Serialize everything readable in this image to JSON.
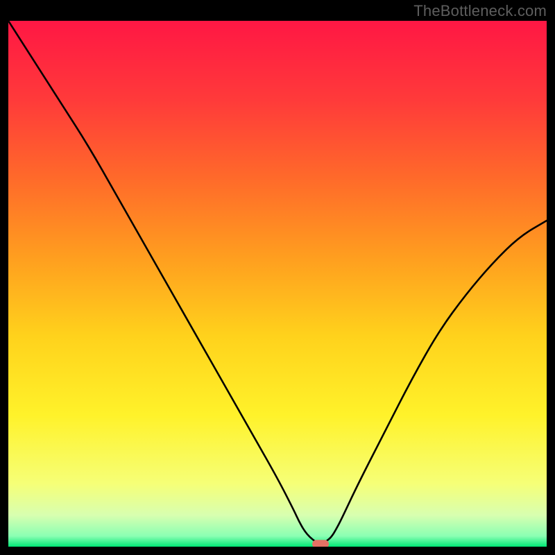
{
  "watermark": "TheBottleneck.com",
  "marker_color": "#e47165",
  "chart_data": {
    "type": "line",
    "title": "",
    "xlabel": "",
    "ylabel": "",
    "xlim": [
      0,
      100
    ],
    "ylim": [
      0,
      100
    ],
    "grid": false,
    "legend": false,
    "series": [
      {
        "name": "left-branch",
        "x": [
          0,
          5,
          10,
          15,
          20,
          25,
          30,
          35,
          40,
          45,
          50,
          53,
          54,
          55,
          56,
          57
        ],
        "values": [
          100,
          92,
          84,
          76,
          67,
          58,
          49,
          40,
          31,
          22,
          13,
          7,
          4.8,
          3,
          1.8,
          1.0
        ]
      },
      {
        "name": "right-branch",
        "x": [
          59,
          60,
          61,
          62,
          65,
          70,
          75,
          80,
          85,
          90,
          95,
          100
        ],
        "values": [
          1.0,
          1.8,
          3.5,
          5.5,
          12,
          22,
          32,
          41,
          48,
          54,
          59,
          62
        ]
      }
    ],
    "annotations": [
      {
        "name": "optimal-marker",
        "x": 58,
        "y": 0.5,
        "color": "#e47165"
      }
    ],
    "background": {
      "type": "vertical-gradient",
      "ylim": [
        0,
        100
      ],
      "stops": [
        {
          "y": 100,
          "color": "#ff1744"
        },
        {
          "y": 85,
          "color": "#ff3a3a"
        },
        {
          "y": 70,
          "color": "#ff6a2a"
        },
        {
          "y": 55,
          "color": "#ff9e1f"
        },
        {
          "y": 40,
          "color": "#ffd21c"
        },
        {
          "y": 25,
          "color": "#fff22a"
        },
        {
          "y": 12,
          "color": "#f6ff77"
        },
        {
          "y": 6,
          "color": "#d8ffb0"
        },
        {
          "y": 2,
          "color": "#8affb3"
        },
        {
          "y": 0,
          "color": "#00e676"
        }
      ]
    }
  }
}
